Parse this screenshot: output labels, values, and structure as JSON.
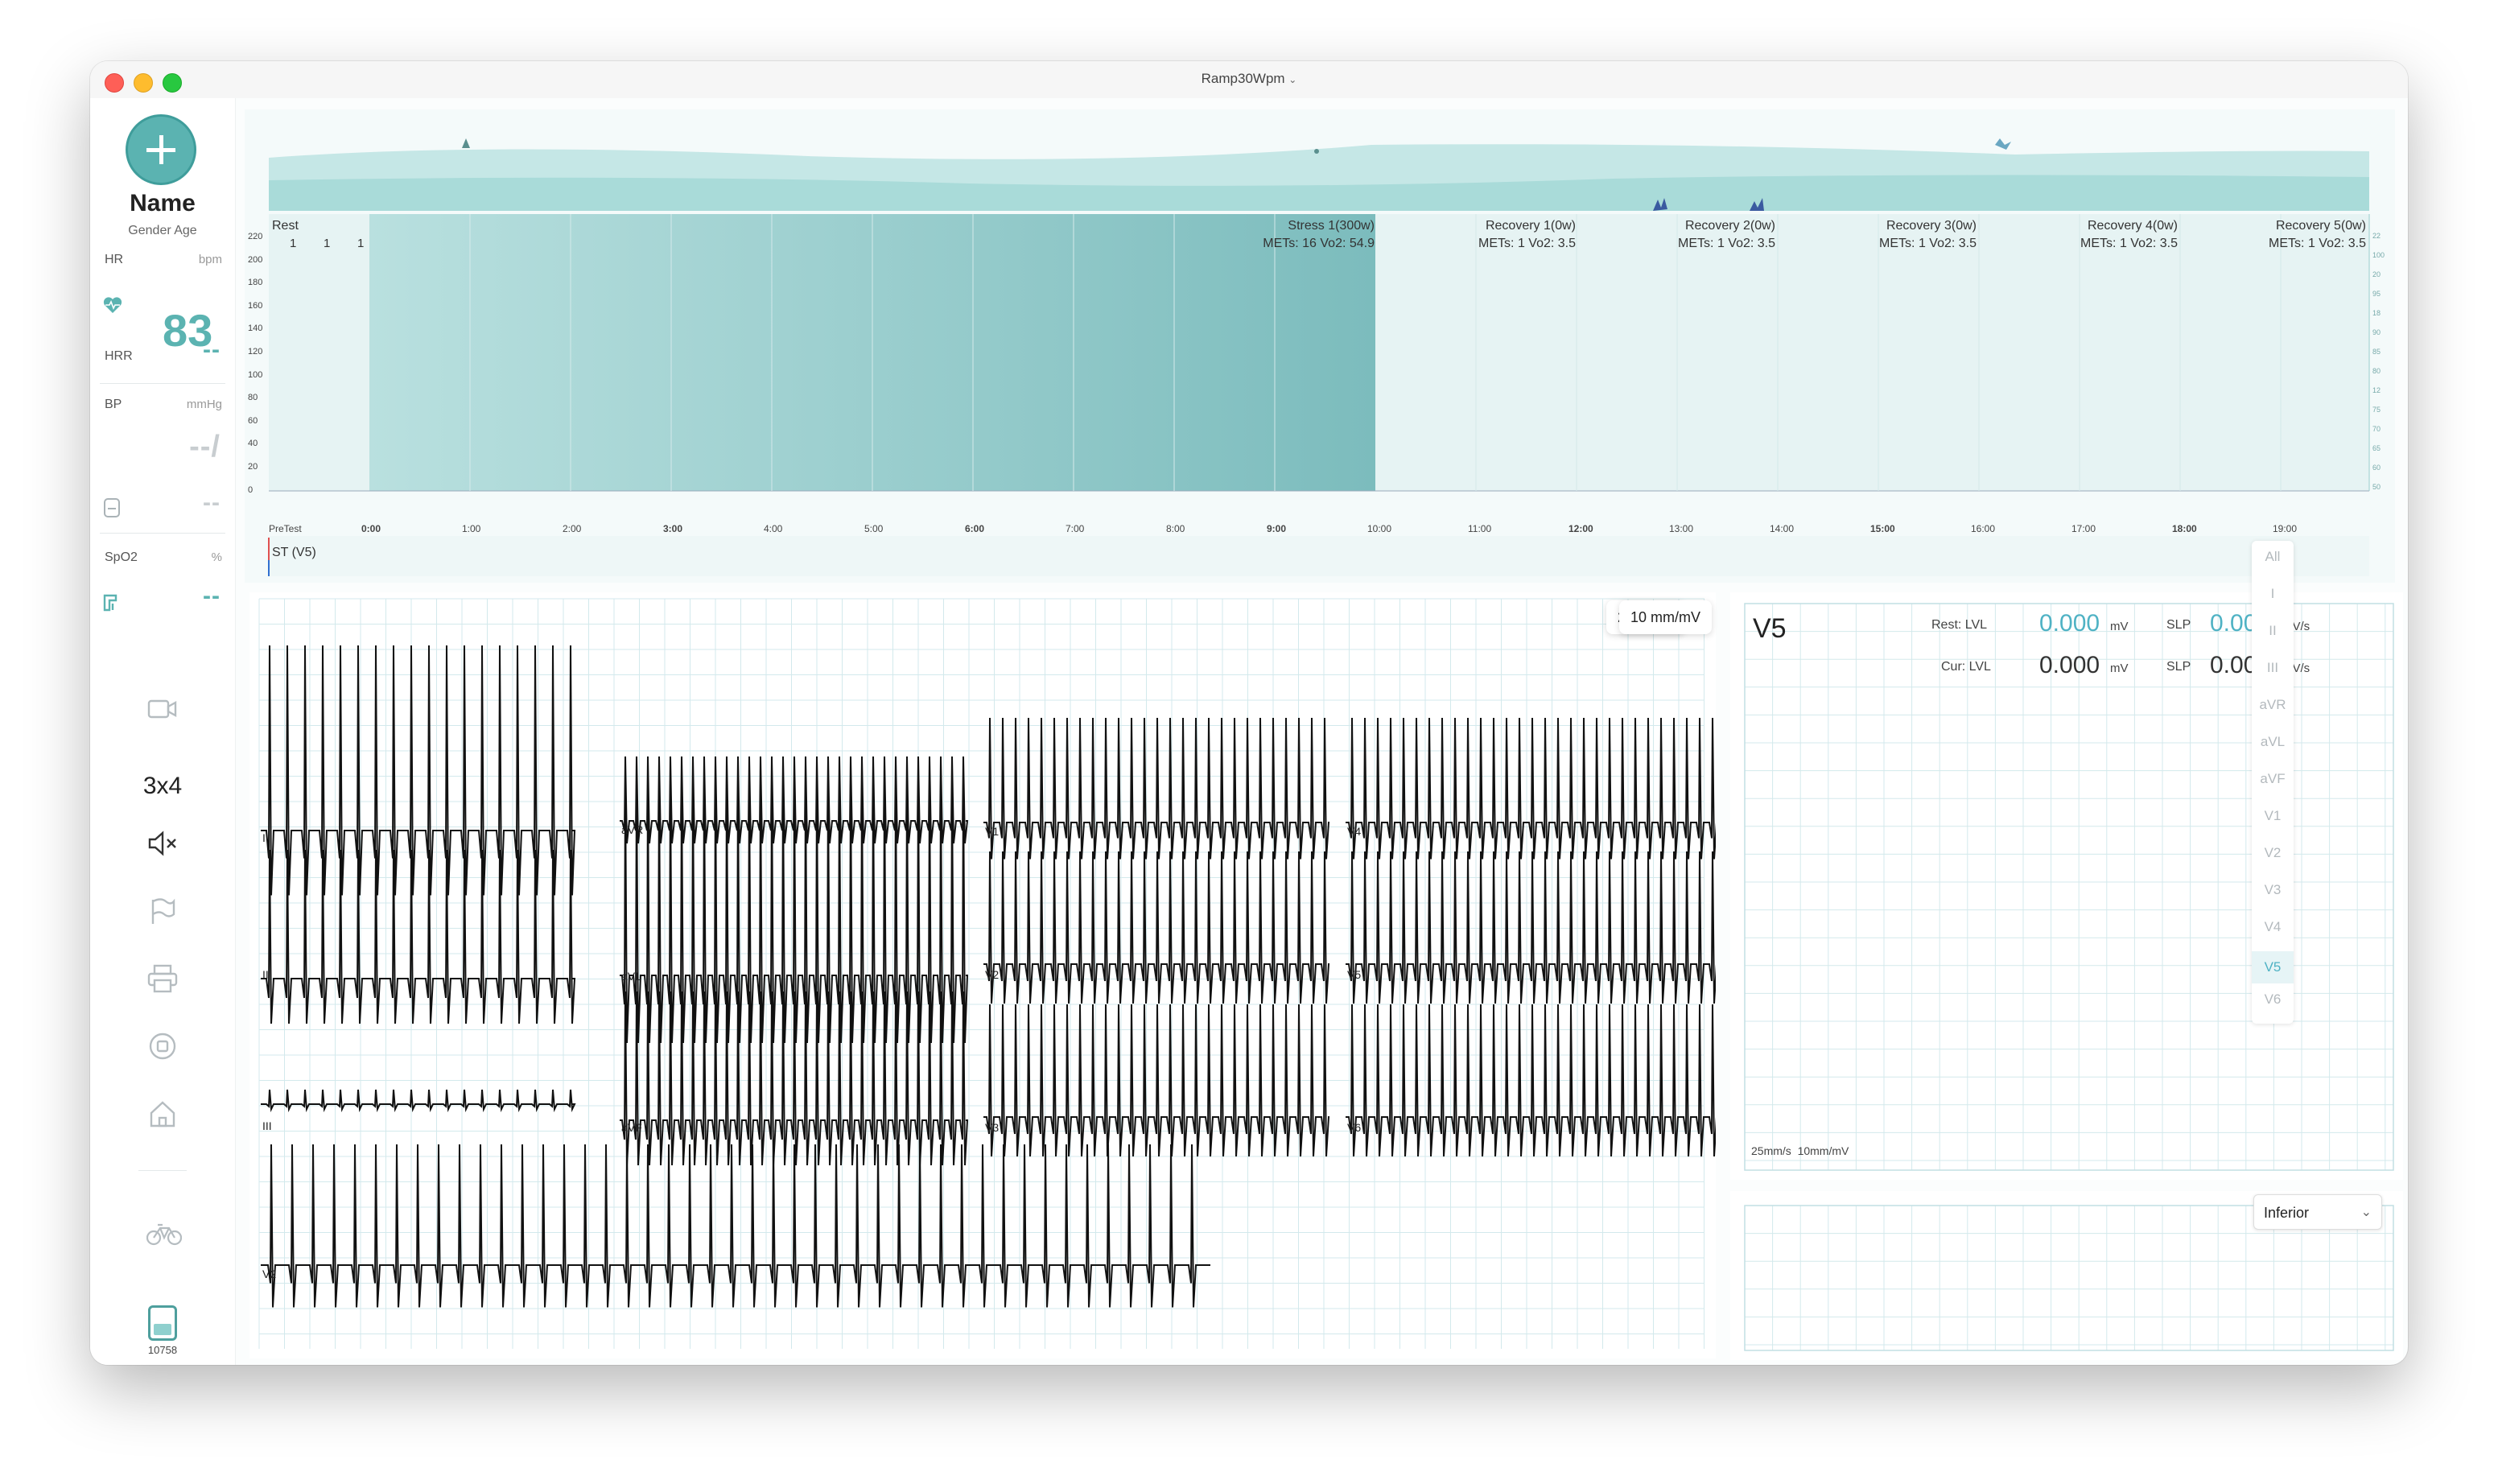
{
  "window": {
    "title": "Ramp30Wpm"
  },
  "patient": {
    "name": "Name",
    "sub": "Gender Age"
  },
  "vitals": {
    "hr_label": "HR",
    "hr_unit": "bpm",
    "hr_value": "83",
    "hrr_label": "HRR",
    "hrr_value": "--",
    "bp_label": "BP",
    "bp_unit": "mmHg",
    "bp_value": "--/",
    "cuff_value": "--",
    "spo2_label": "SpO2",
    "spo2_unit": "%",
    "spo2_value": "--"
  },
  "tools": {
    "layout_label": "3x4",
    "battery_label": "10758"
  },
  "stages": [
    {
      "name": "Rest",
      "detail": ""
    },
    {
      "name": "Stress 1(300w)",
      "detail": "METs: 16  Vo2: 54.9"
    },
    {
      "name": "Recovery 1(0w)",
      "detail": "METs: 1  Vo2: 3.5"
    },
    {
      "name": "Recovery 2(0w)",
      "detail": "METs: 1  Vo2: 3.5"
    },
    {
      "name": "Recovery 3(0w)",
      "detail": "METs: 1  Vo2: 3.5"
    },
    {
      "name": "Recovery 4(0w)",
      "detail": "METs: 1  Vo2: 3.5"
    },
    {
      "name": "Recovery 5(0w)",
      "detail": "METs: 1  Vo2: 3.5"
    }
  ],
  "rest_markers": [
    "1",
    "1",
    "1"
  ],
  "yaxis": [
    "220",
    "200",
    "180",
    "160",
    "140",
    "120",
    "100",
    "80",
    "60",
    "40",
    "20",
    "0"
  ],
  "xaxis": [
    "PreTest",
    "0:00",
    "1:00",
    "2:00",
    "3:00",
    "4:00",
    "5:00",
    "6:00",
    "7:00",
    "8:00",
    "9:00",
    "10:00",
    "11:00",
    "12:00",
    "13:00",
    "14:00",
    "15:00",
    "16:00",
    "17:00",
    "18:00",
    "19:00"
  ],
  "st_label": "ST (V5)",
  "ecg": {
    "speed": "25 mm/s",
    "gain": "10 mm/mV",
    "leads": [
      "I",
      "II",
      "III",
      "aVR",
      "aVL",
      "aVF",
      "V1",
      "V2",
      "V3",
      "V4",
      "V5",
      "V6",
      "V2"
    ]
  },
  "st_panel": {
    "lead": "V5",
    "rest_label": "Rest: LVL",
    "rest_lvl": "0.000",
    "rest_lvl_unit": "mV",
    "rest_slp_label": "SLP",
    "rest_slp": "0.000",
    "rest_slp_unit": "mV/s",
    "cur_label": "Cur: LVL",
    "cur_lvl": "0.000",
    "cur_lvl_unit": "mV",
    "cur_slp_label": "SLP",
    "cur_slp": "0.000",
    "cur_slp_unit": "mV/s",
    "footer": "25mm/s  10mm/mV"
  },
  "lead_list": [
    "All",
    "I",
    "II",
    "III",
    "aVR",
    "aVL",
    "aVF",
    "V1",
    "V2",
    "V3",
    "V4",
    "V5",
    "V6"
  ],
  "lead_selected": "V5",
  "group_select": "Inferior",
  "colors": {
    "accent": "#5bb3b1",
    "metric": "#4fb2c4",
    "grid": "#d5ebee"
  }
}
